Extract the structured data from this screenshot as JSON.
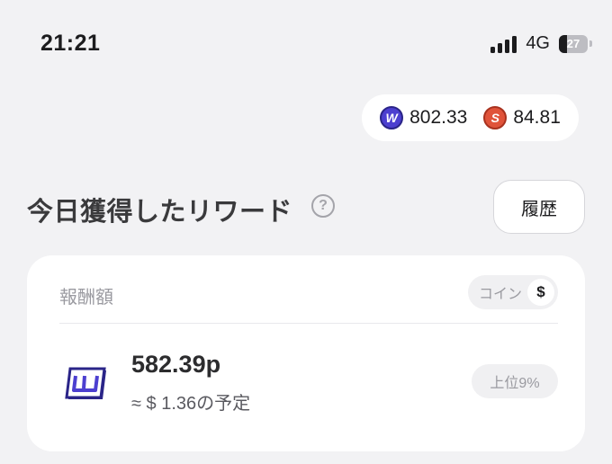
{
  "status_bar": {
    "time": "21:21",
    "network": "4G",
    "battery_level": "27",
    "battery_fraction": 0.27,
    "signal_bars": 4
  },
  "balances": [
    {
      "icon": "w-coin-icon",
      "value": "802.33",
      "letter": "W",
      "color": "#4c3fd0"
    },
    {
      "icon": "s-coin-icon",
      "value": "84.81",
      "letter": "S",
      "color": "#e0533a"
    }
  ],
  "header": {
    "title": "今日獲得したリワード",
    "help_symbol": "?",
    "history_label": "履歴"
  },
  "reward_card": {
    "label": "報酬額",
    "unit_toggle": {
      "coin_label": "コイン",
      "dollar_label": "$",
      "selected": "$"
    },
    "points": "582.39p",
    "estimate": "≈ $ 1.36の予定",
    "rank": "上位9%",
    "brand_color": "#4c3fd0"
  }
}
